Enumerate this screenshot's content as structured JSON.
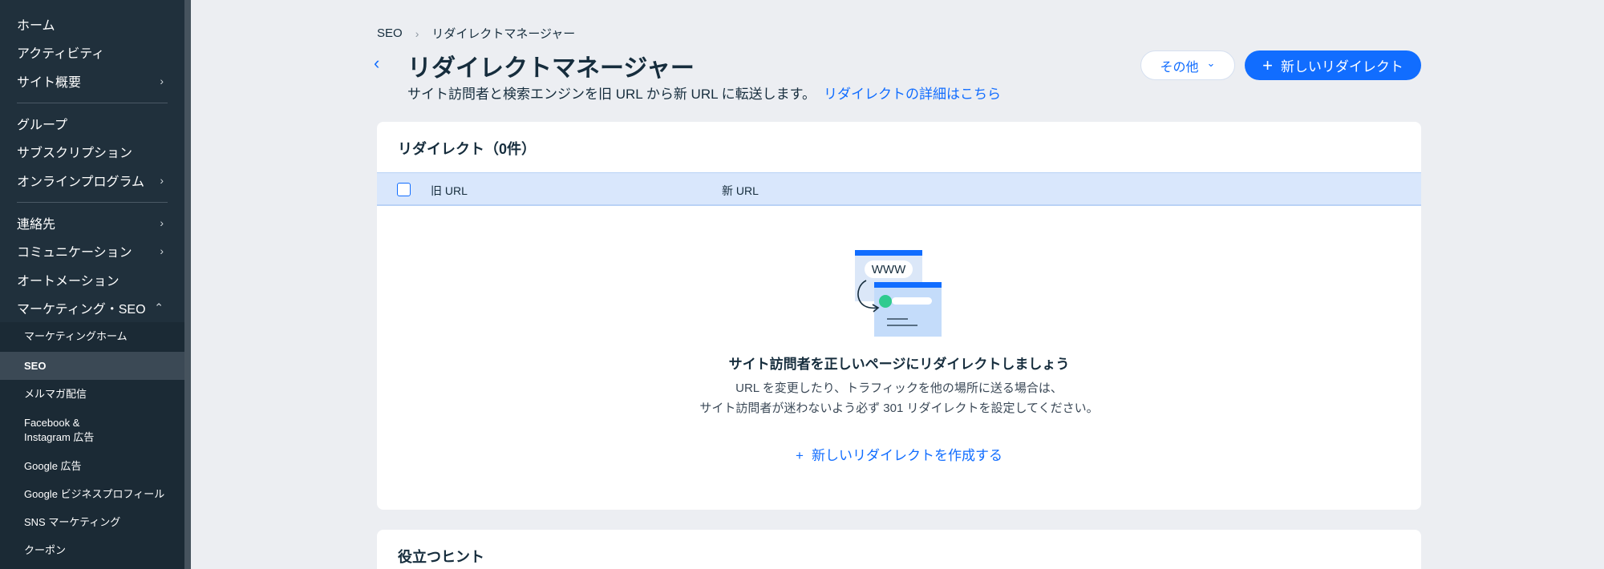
{
  "sidebar": {
    "items": [
      {
        "label": "ホーム"
      },
      {
        "label": "アクティビティ"
      },
      {
        "label": "サイト概要",
        "chevron": "›"
      },
      {
        "label": "グループ"
      },
      {
        "label": "サブスクリプション"
      },
      {
        "label": "オンラインプログラム",
        "chevron": "›"
      },
      {
        "label": "連絡先",
        "chevron": "›"
      },
      {
        "label": "コミュニケーション",
        "chevron": "›"
      },
      {
        "label": "オートメーション"
      },
      {
        "label": "マーケティング・SEO",
        "chevron": "⌃"
      }
    ],
    "sub_items": [
      {
        "label": "マーケティングホーム"
      },
      {
        "label": "SEO"
      },
      {
        "label": "メルマガ配信"
      },
      {
        "label": "Facebook &",
        "label2": "Instagram 広告"
      },
      {
        "label": "Google 広告"
      },
      {
        "label": "Google ビジネスプロフィール"
      },
      {
        "label": "SNS マーケティング"
      },
      {
        "label": "クーポン"
      }
    ]
  },
  "breadcrumb": {
    "root": "SEO",
    "separator": "›",
    "current": "リダイレクトマネージャー"
  },
  "header": {
    "back_icon": "‹",
    "title": "リダイレクトマネージャー",
    "subtitle": "サイト訪問者と検索エンジンを旧 URL から新 URL に転送します。",
    "learn_more": "リダイレクトの詳細はこちら",
    "more_label": "その他",
    "more_chevron": "⌄",
    "new_label": "新しいリダイレクト",
    "new_plus": "+"
  },
  "card": {
    "title": "リダイレクト（0件）",
    "columns": {
      "old": "旧 URL",
      "new": "新 URL"
    },
    "empty": {
      "illustration_text": "WWW",
      "title": "サイト訪問者を正しいページにリダイレクトしましょう",
      "desc_line1": "URL を変更したり、トラフィックを他の場所に送る場合は、",
      "desc_line2": "サイト訪問者が迷わないよう必ず 301 リダイレクトを設定してください。",
      "create_plus": "+",
      "create_label": "新しいリダイレクトを作成する"
    }
  },
  "tips": {
    "title": "役立つヒント"
  },
  "colors": {
    "accent": "#116dff",
    "sidebar": "#20303c",
    "header_row": "#d9e7fc",
    "illus_green": "#2fcb8f"
  }
}
